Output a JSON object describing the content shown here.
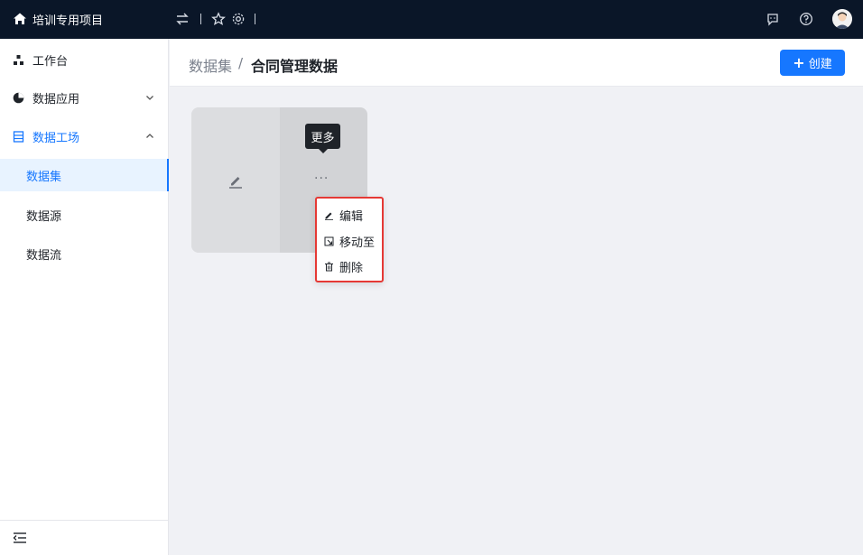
{
  "topbar": {
    "project_name": "培训专用项目",
    "icons": [
      "home-icon",
      "switch-icon",
      "star-icon",
      "gear-icon",
      "chat-icon",
      "help-icon",
      "avatar"
    ]
  },
  "sidebar": {
    "items": [
      {
        "label": "工作台",
        "icon": "workbench-icon"
      },
      {
        "label": "数据应用",
        "icon": "pie-chart-icon"
      },
      {
        "label": "数据工场",
        "icon": "list-icon"
      }
    ],
    "sub_items": [
      {
        "label": "数据集",
        "active": true
      },
      {
        "label": "数据源",
        "active": false
      },
      {
        "label": "数据流",
        "active": false
      }
    ]
  },
  "header": {
    "breadcrumb_parent": "数据集",
    "breadcrumb_sep": "/",
    "breadcrumb_current": "合同管理数据",
    "create_label": "创建"
  },
  "card": {
    "tooltip": "更多",
    "more_label": "···"
  },
  "menu": {
    "items": [
      {
        "label": "编辑",
        "icon": "pencil-icon"
      },
      {
        "label": "移动至",
        "icon": "move-icon"
      },
      {
        "label": "删除",
        "icon": "trash-icon"
      }
    ]
  },
  "colors": {
    "topbar_bg": "#0a1628",
    "accent": "#1677ff",
    "highlight_border": "#e53935"
  }
}
